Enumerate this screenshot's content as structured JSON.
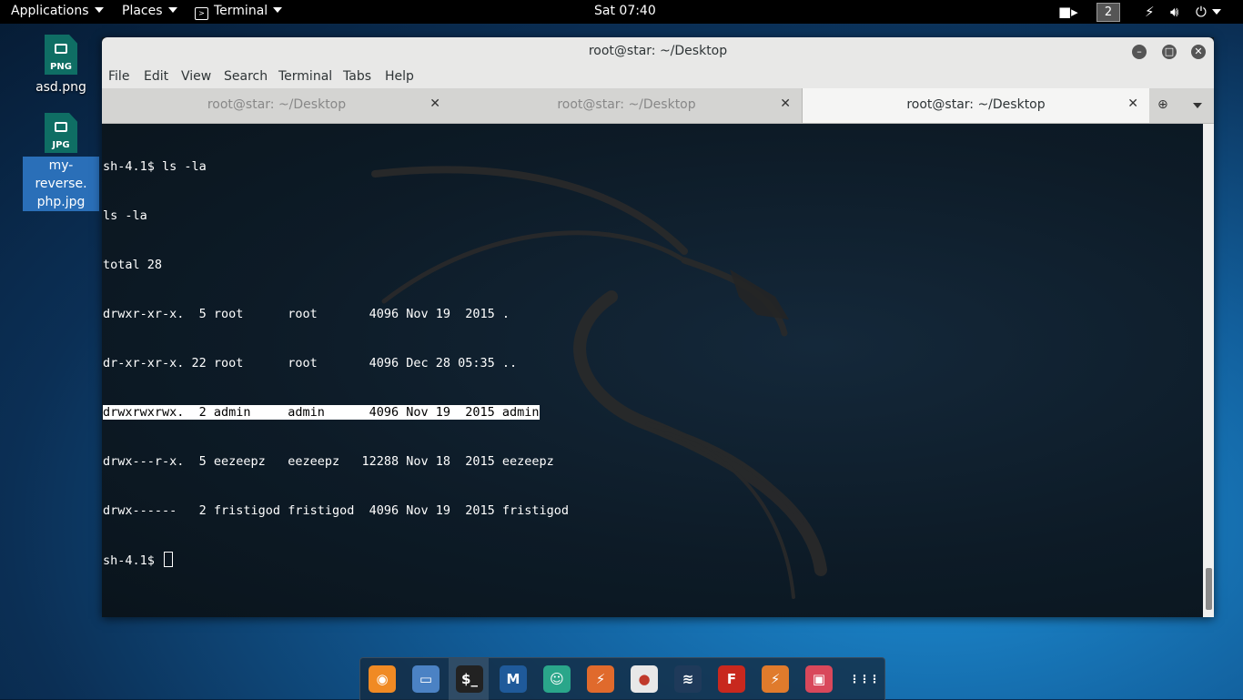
{
  "topbar": {
    "applications": "Applications",
    "places": "Places",
    "terminal": "Terminal",
    "clock": "Sat 07:40",
    "workspace": "2",
    "icons": [
      "camera-icon",
      "network-icon",
      "volume-icon",
      "power-icon"
    ]
  },
  "desktop": {
    "icons": [
      {
        "label": "asd.png",
        "type": "PNG"
      },
      {
        "label": "my-reverse.\nphp.jpg",
        "type": "JPG"
      }
    ]
  },
  "window": {
    "title": "root@star: ~/Desktop",
    "menu": [
      "File",
      "Edit",
      "View",
      "Search",
      "Terminal",
      "Tabs",
      "Help"
    ],
    "tabs": [
      {
        "label": "root@star: ~/Desktop",
        "active": false
      },
      {
        "label": "root@star: ~/Desktop",
        "active": false
      },
      {
        "label": "root@star: ~/Desktop",
        "active": true
      }
    ]
  },
  "terminal": {
    "lines": [
      "sh-4.1$ ls -la",
      "ls -la",
      "total 28",
      "drwxr-xr-x.  5 root      root       4096 Nov 19  2015 .",
      "dr-xr-xr-x. 22 root      root       4096 Dec 28 05:35 ..",
      "drwxrwxrwx.  2 admin     admin      4096 Nov 19  2015 admin",
      "drwx---r-x.  5 eezeepz   eezeepz   12288 Nov 18  2015 eezeepz",
      "drwx------   2 fristigod fristigod  4096 Nov 19  2015 fristigod"
    ],
    "prompt": "sh-4.1$ "
  },
  "dock": {
    "apps": [
      {
        "name": "firefox-icon",
        "glyph": "◉",
        "color": "#f08a24"
      },
      {
        "name": "files-icon",
        "glyph": "▭",
        "color": "#4b82c4"
      },
      {
        "name": "terminal-app-icon",
        "glyph": "$_",
        "color": "#222222"
      },
      {
        "name": "metasploit-icon",
        "glyph": "M",
        "color": "#1f5a9a"
      },
      {
        "name": "armitage-icon",
        "glyph": "☺",
        "color": "#2aa68a"
      },
      {
        "name": "burpsuite-icon",
        "glyph": "⚡",
        "color": "#e06a2c"
      },
      {
        "name": "maltego-icon",
        "glyph": "●",
        "color": "#e8e8e8"
      },
      {
        "name": "kali-dragon-icon",
        "glyph": "≋",
        "color": "#1f3a5a"
      },
      {
        "name": "faraday-icon",
        "glyph": "F",
        "color": "#c8281e"
      },
      {
        "name": "zap-icon",
        "glyph": "⚡",
        "color": "#e07b2c"
      },
      {
        "name": "image-viewer-icon",
        "glyph": "▣",
        "color": "#d9485b"
      },
      {
        "name": "show-apps-icon",
        "glyph": "⋮⋮⋮",
        "color": "transparent"
      }
    ]
  }
}
